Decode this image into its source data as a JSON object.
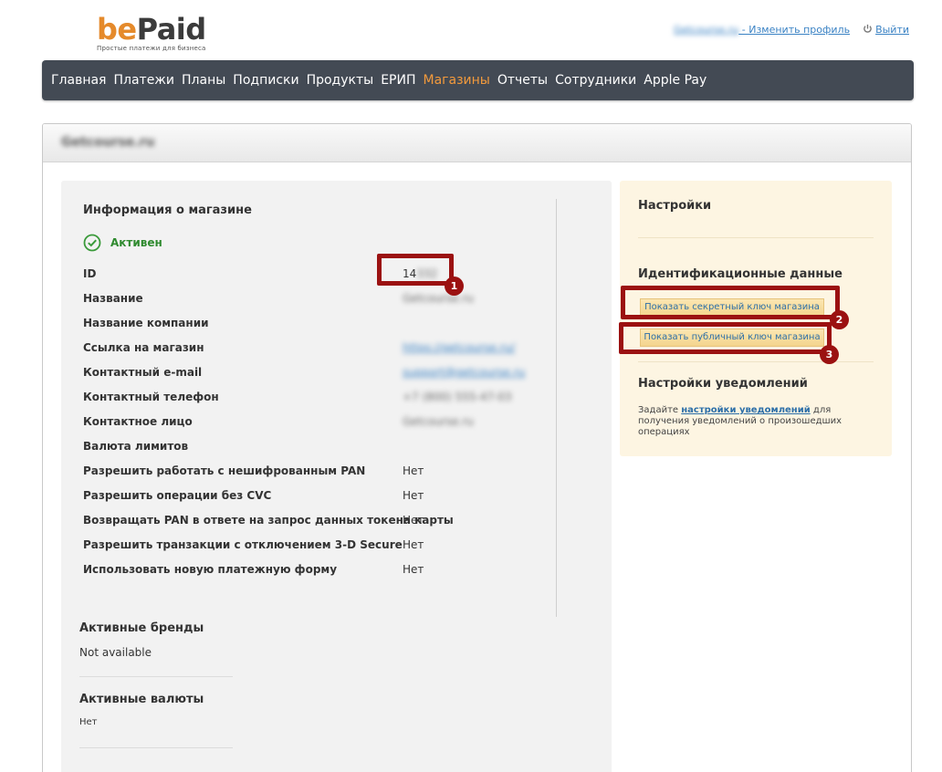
{
  "brand": {
    "name_part1": "be",
    "name_part2": "Paid",
    "tagline": "Простые платежи для бизнеса"
  },
  "top_links": {
    "shop_name": "Getcourse.ru",
    "edit_profile": " - Изменить профиль ",
    "logout": "Выйти"
  },
  "nav": {
    "items": [
      "Главная",
      "Платежи",
      "Планы",
      "Подписки",
      "Продукты",
      "ЕРИП",
      "Магазины",
      "Отчеты",
      "Сотрудники",
      "Apple Pay"
    ],
    "active_index": 6
  },
  "panel": {
    "title": "Getcourse.ru"
  },
  "info": {
    "title": "Информация о магазине",
    "status": "Активен",
    "rows": [
      {
        "label": "ID",
        "value": "14",
        "value_hidden": "332"
      },
      {
        "label": "Название",
        "value": "Getcourse.ru"
      },
      {
        "label": "Название компании",
        "value": ""
      },
      {
        "label": "Ссылка на магазин",
        "value": "https://getcourse.ru/"
      },
      {
        "label": "Контактный e-mail",
        "value": "support@getcourse.ru"
      },
      {
        "label": "Контактный телефон",
        "value": "+7 (800) 555-47-03"
      },
      {
        "label": "Контактное лицо",
        "value": "Getcourse.ru"
      },
      {
        "label": "Валюта лимитов",
        "value": ""
      },
      {
        "label": "Разрешить работать с нешифрованным PAN",
        "value": "Нет"
      },
      {
        "label": "Разрешить операции без CVC",
        "value": "Нет"
      },
      {
        "label": "Возвращать PAN в ответе на запрос данных токена карты",
        "value": "Нет"
      },
      {
        "label": "Разрешить транзакции с отключением 3-D Secure",
        "value": "Нет"
      },
      {
        "label": "Использовать новую платежную форму",
        "value": "Нет"
      }
    ],
    "brands_title": "Активные бренды",
    "brands_value": "Not available",
    "currencies_title": "Активные валюты",
    "currencies_value": "Нет"
  },
  "settings": {
    "title": "Настройки",
    "ident_title": "Идентификационные данные",
    "secret_key_button": "Показать секретный ключ магазина",
    "public_key_button": "Показать публичный ключ магазина",
    "notify_title": "Настройки уведомлений",
    "notify_prefix": "Задайте ",
    "notify_link": "настройки уведомлений",
    "notify_suffix": " для получения уведомлений о произошедших операциях"
  },
  "annotations": {
    "badge1": "1",
    "badge2": "2",
    "badge3": "3",
    "color": "#9b1111"
  },
  "colors": {
    "nav_bg": "#434a54",
    "nav_active": "#f39a3c",
    "brand_orange": "#e58a2b",
    "status_green": "#2f8a2f",
    "link_blue": "#3a82c4"
  }
}
